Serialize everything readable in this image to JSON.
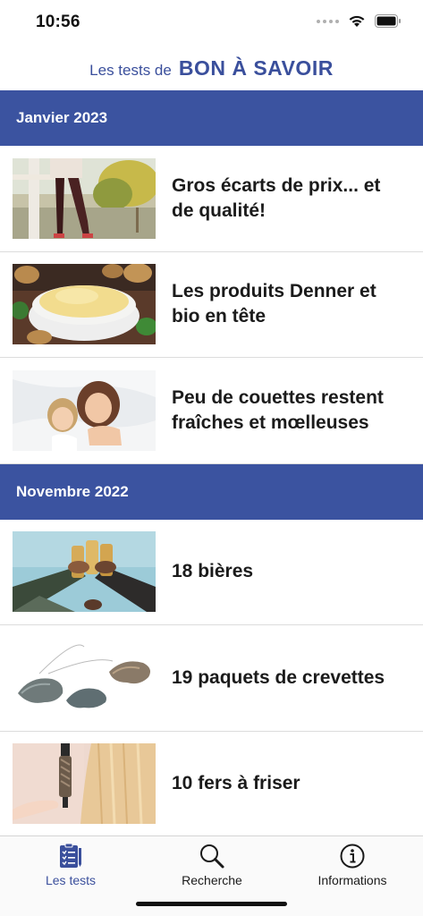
{
  "status_bar": {
    "time": "10:56"
  },
  "header": {
    "logo_prefix": "Les tests de",
    "logo_main": "BON À SAVOIR"
  },
  "sections": [
    {
      "title": "Janvier 2023",
      "articles": [
        {
          "title": "Gros écarts de prix... et de qualité!",
          "image": "legs-tights-photo"
        },
        {
          "title": "Les produits Denner et bio en tête",
          "image": "mashed-potatoes-photo"
        },
        {
          "title": "Peu de couettes restent fraîches et mœlleuses",
          "image": "family-duvet-photo"
        }
      ]
    },
    {
      "title": "Novembre 2022",
      "articles": [
        {
          "title": "18 bières",
          "image": "beer-toast-photo"
        },
        {
          "title": "19 paquets de crevettes",
          "image": "shrimp-photo"
        },
        {
          "title": "10 fers à friser",
          "image": "curling-iron-photo"
        }
      ]
    }
  ],
  "tabs": [
    {
      "label": "Les tests",
      "icon": "checklist-icon",
      "active": true
    },
    {
      "label": "Recherche",
      "icon": "search-icon",
      "active": false
    },
    {
      "label": "Informations",
      "icon": "info-icon",
      "active": false
    }
  ],
  "colors": {
    "brand_blue": "#3b53a0",
    "logo_blue": "#3a4f9c"
  }
}
